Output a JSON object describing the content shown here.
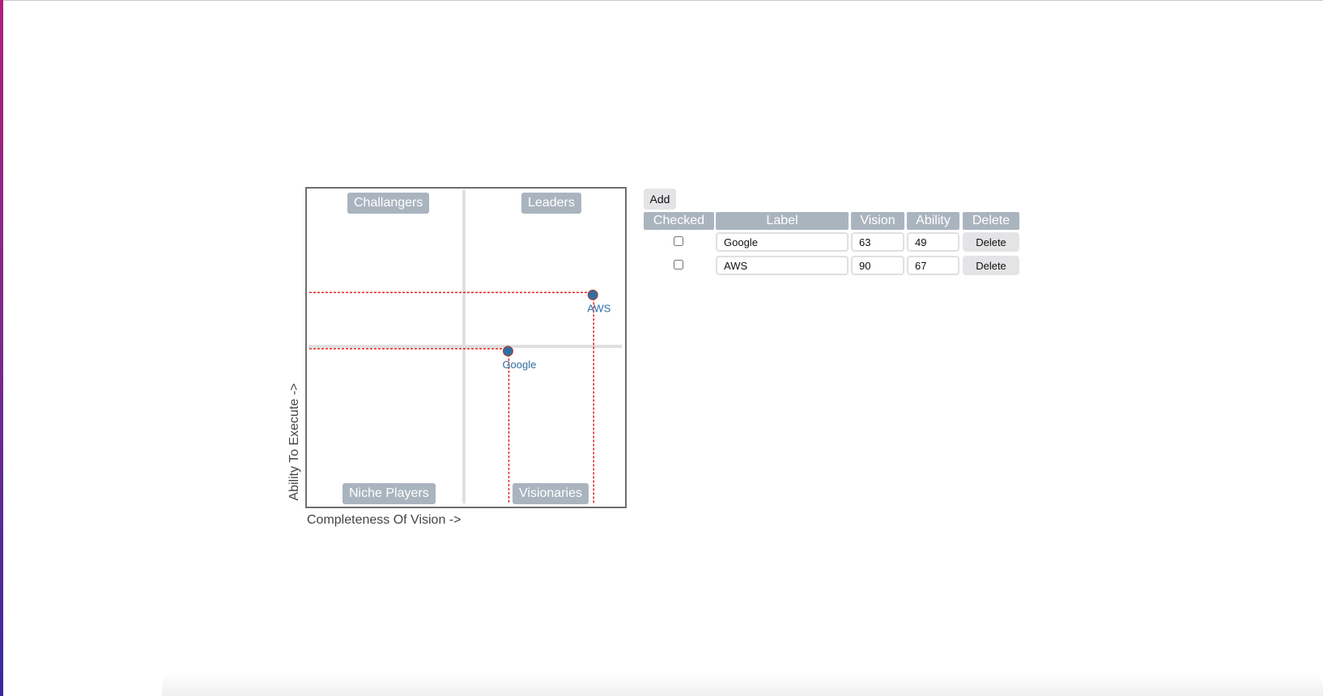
{
  "chart": {
    "quadrants": {
      "top_left": "Challangers",
      "top_right": "Leaders",
      "bottom_left": "Niche Players",
      "bottom_right": "Visionaries"
    },
    "xlabel": "Completeness Of Vision ->",
    "ylabel": "Ability To Execute ->"
  },
  "chart_data": {
    "type": "scatter",
    "quadrant_chart": true,
    "xlim": [
      0,
      100
    ],
    "ylim": [
      0,
      100
    ],
    "xlabel": "Completeness Of Vision ->",
    "ylabel": "Ability To Execute ->",
    "points": [
      {
        "label": "Google",
        "x": 63,
        "y": 49
      },
      {
        "label": "AWS",
        "x": 90,
        "y": 67
      }
    ],
    "point_color": "#2f6fa3",
    "guide_color": "#e02020",
    "grid": false
  },
  "controls": {
    "add_label": "Add"
  },
  "table": {
    "headers": {
      "checked": "Checked",
      "label": "Label",
      "vision": "Vision",
      "ability": "Ability",
      "delete": "Delete"
    },
    "rows": [
      {
        "checked": false,
        "label": "Google",
        "vision": "63",
        "ability": "49",
        "delete_label": "Delete"
      },
      {
        "checked": false,
        "label": "AWS",
        "vision": "90",
        "ability": "67",
        "delete_label": "Delete"
      }
    ]
  }
}
